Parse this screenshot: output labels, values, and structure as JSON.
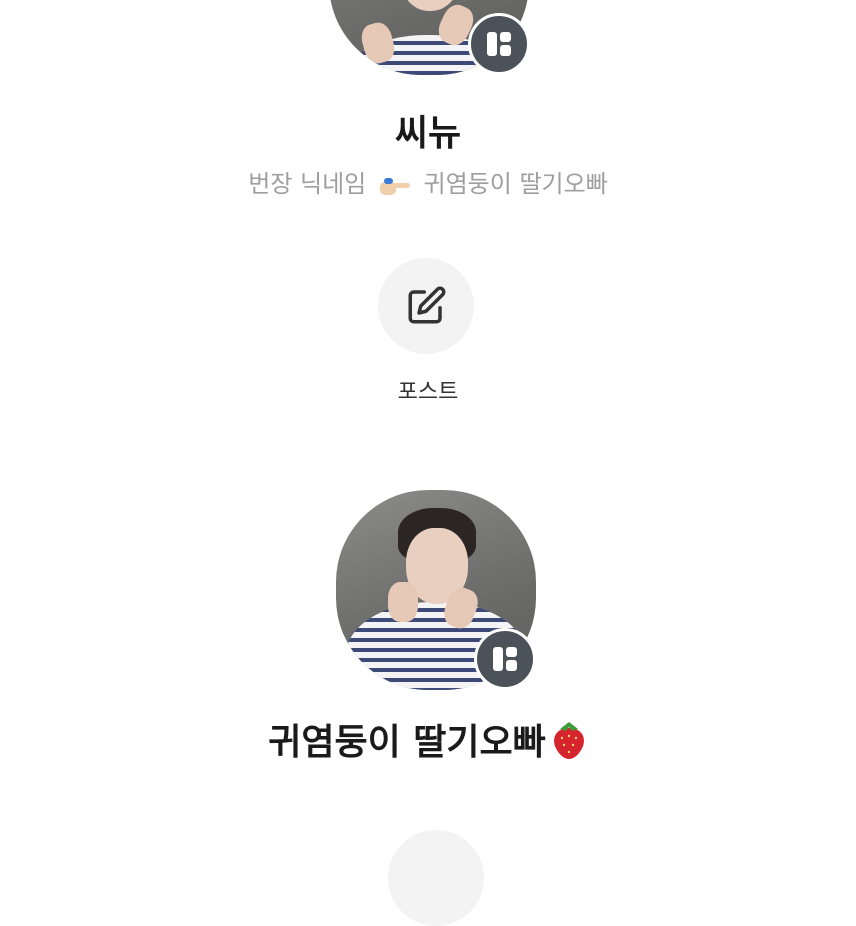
{
  "profile_top": {
    "name": "씨뉴",
    "bio_prefix": "번장 닉네임",
    "bio_suffix": "귀염둥이 딸기오빠",
    "bio_icon": "pointing-hand-emoji",
    "photo_icon": "person-photo",
    "badge_icon": "grid-widget-icon"
  },
  "action": {
    "label": "포스트",
    "icon": "edit-pencil-icon"
  },
  "profile_bottom": {
    "name": "귀염둥이 딸기오빠",
    "name_icon": "strawberry-emoji",
    "badge_icon": "grid-widget-icon"
  },
  "colors": {
    "badge_bg": "#4b5259",
    "action_bg": "#f3f3f4",
    "bio_text": "#9e9e9e"
  }
}
